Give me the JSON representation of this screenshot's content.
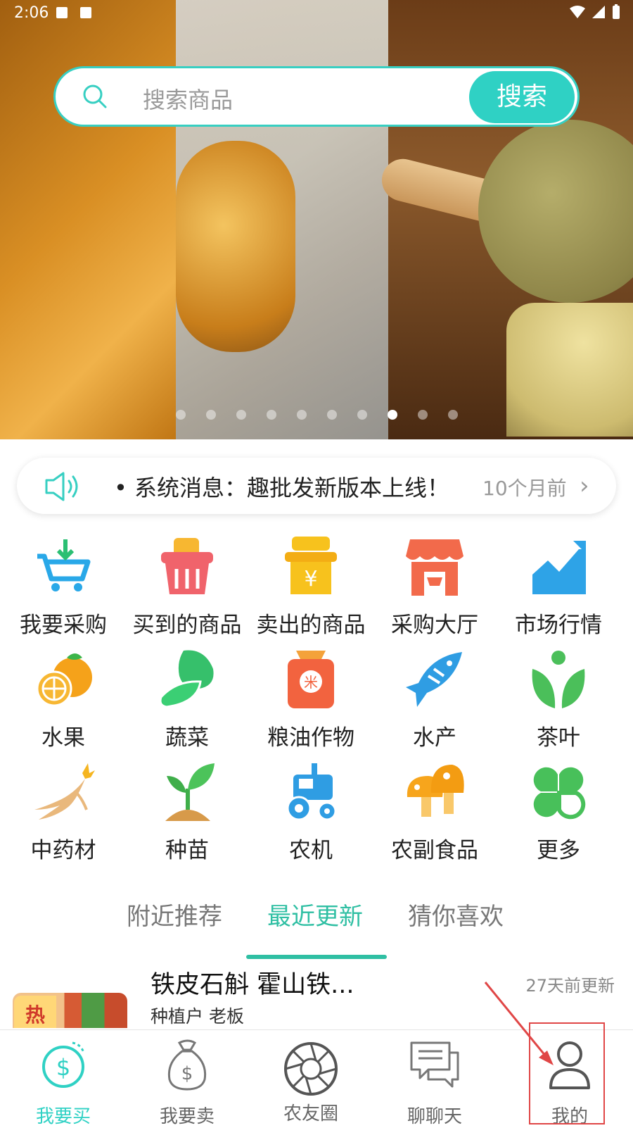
{
  "status_bar": {
    "time": "2:06"
  },
  "search": {
    "placeholder": "搜索商品",
    "button": "搜索"
  },
  "banner": {
    "dot_count": 10,
    "active_dot": 8
  },
  "notice": {
    "text": "• 系统消息：趣批发新版本上线！",
    "time": "10个月前"
  },
  "shortcuts": [
    {
      "label": "我要采购",
      "icon": "cart-download-icon"
    },
    {
      "label": "买到的商品",
      "icon": "basket-icon"
    },
    {
      "label": "卖出的商品",
      "icon": "yen-box-icon"
    },
    {
      "label": "采购大厅",
      "icon": "store-icon"
    },
    {
      "label": "市场行情",
      "icon": "trend-chart-icon"
    }
  ],
  "categories": [
    {
      "label": "水果",
      "icon": "orange-icon"
    },
    {
      "label": "蔬菜",
      "icon": "vegetable-icon"
    },
    {
      "label": "粮油作物",
      "icon": "rice-bag-icon"
    },
    {
      "label": "水产",
      "icon": "fish-icon"
    },
    {
      "label": "茶叶",
      "icon": "tea-leaf-icon"
    },
    {
      "label": "中药材",
      "icon": "ginseng-icon"
    },
    {
      "label": "种苗",
      "icon": "sprout-icon"
    },
    {
      "label": "农机",
      "icon": "tractor-icon"
    },
    {
      "label": "农副食品",
      "icon": "mushroom-icon"
    },
    {
      "label": "更多",
      "icon": "more-clover-icon"
    }
  ],
  "tabs": [
    {
      "label": "附近推荐"
    },
    {
      "label": "最近更新",
      "active": true
    },
    {
      "label": "猜你喜欢"
    }
  ],
  "product": {
    "title": "铁皮石斛 霍山铁...",
    "subtitle": "种植户 老板",
    "updated": "27天前更新",
    "badge": "热"
  },
  "tabbar": [
    {
      "label": "我要买",
      "icon": "buy-coin-icon",
      "active": true
    },
    {
      "label": "我要卖",
      "icon": "money-bag-icon"
    },
    {
      "label": "农友圈",
      "icon": "aperture-icon"
    },
    {
      "label": "聊聊天",
      "icon": "chat-icon"
    },
    {
      "label": "我的",
      "icon": "user-icon"
    }
  ],
  "colors": {
    "accent": "#2fd1c4",
    "tab_active": "#2fbfa3",
    "annotation_red": "#e04646"
  }
}
